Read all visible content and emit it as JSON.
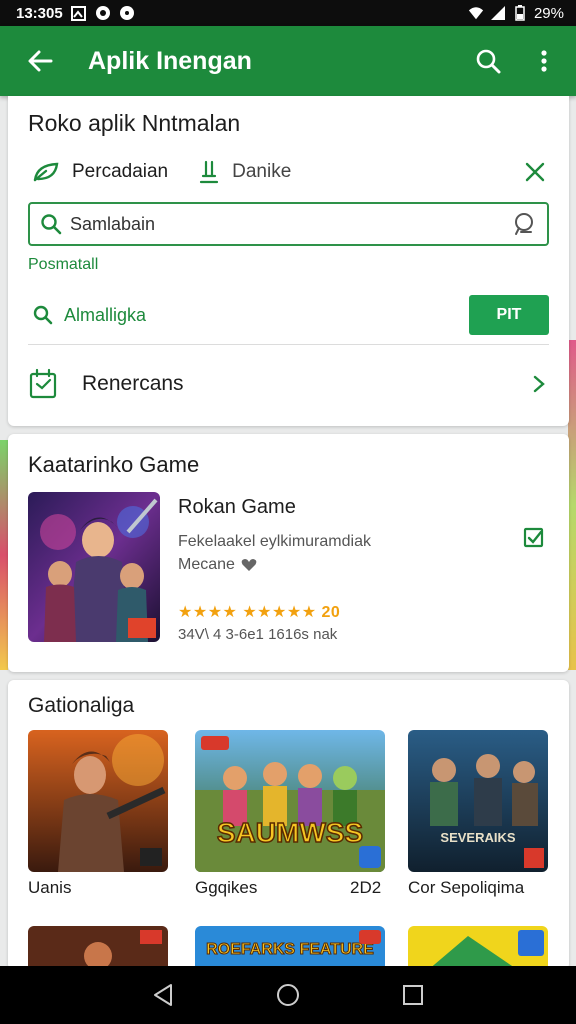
{
  "status_bar": {
    "time": "13:305",
    "battery": "29%"
  },
  "app_bar": {
    "title": "Aplik Inengan",
    "back_icon": "arrow-back-icon",
    "search_icon": "search-icon",
    "menu_icon": "more-vert-icon"
  },
  "search_card": {
    "title": "Roko aplik Nntmalan",
    "filters": [
      {
        "label": "Percadaian",
        "icon": "leaf-icon"
      },
      {
        "label": "Danike",
        "icon": "pin-icon"
      }
    ],
    "search": {
      "placeholder": "",
      "value": "Samlabain"
    },
    "hint": "Posmatall",
    "alt": {
      "label": "Almalligka",
      "button": "PIT"
    },
    "nav": {
      "label": "Renercans"
    }
  },
  "featured": {
    "title": "Kaatarinko Game",
    "game": {
      "title": "Rokan Game",
      "desc": "Fekelaakel eylkimuramdiak",
      "desc2": "Mecane",
      "rating": "★★★★ ★★★★★ 20",
      "meta": "34V\\ 4 3-6e1 1616s nak"
    }
  },
  "collection": {
    "title": "Gationaliga",
    "items": [
      {
        "label": "Uanis",
        "extra": ""
      },
      {
        "label": "Ggqikes",
        "extra": "2D2"
      },
      {
        "label": "Cor Sepoliqima",
        "extra": ""
      }
    ],
    "tile2_text": "ROEFARKS FEATURE"
  },
  "colors": {
    "accent": "#1d8a3c",
    "button": "#1fa152",
    "star": "#f2a10f"
  }
}
